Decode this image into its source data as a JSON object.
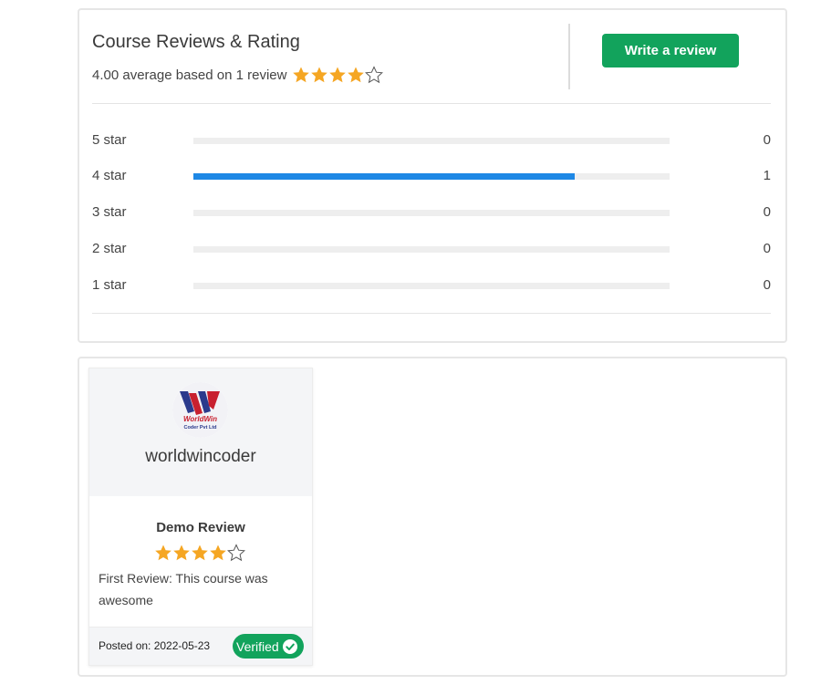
{
  "summary": {
    "title": "Course Reviews & Rating",
    "average_text": "4.00 average based on 1 review",
    "average_rating": 4,
    "write_review_label": "Write a review",
    "rows": [
      {
        "label": "5 star",
        "count": "0",
        "fraction": 0
      },
      {
        "label": "4 star",
        "count": "1",
        "fraction": 0.8
      },
      {
        "label": "3 star",
        "count": "0",
        "fraction": 0
      },
      {
        "label": "2 star",
        "count": "0",
        "fraction": 0
      },
      {
        "label": "1 star",
        "count": "0",
        "fraction": 0
      }
    ]
  },
  "review": {
    "username": "worldwincoder",
    "avatar_text": "WorldWin Coder Pvt Ltd",
    "title": "Demo Review",
    "rating": 4,
    "text": "First Review: This course was awesome",
    "posted": "Posted on: 2022-05-23",
    "verified_label": "Verified"
  },
  "colors": {
    "accent_green": "#12a35c",
    "bar_blue": "#1e88e5",
    "star_gold": "#f5a623"
  }
}
